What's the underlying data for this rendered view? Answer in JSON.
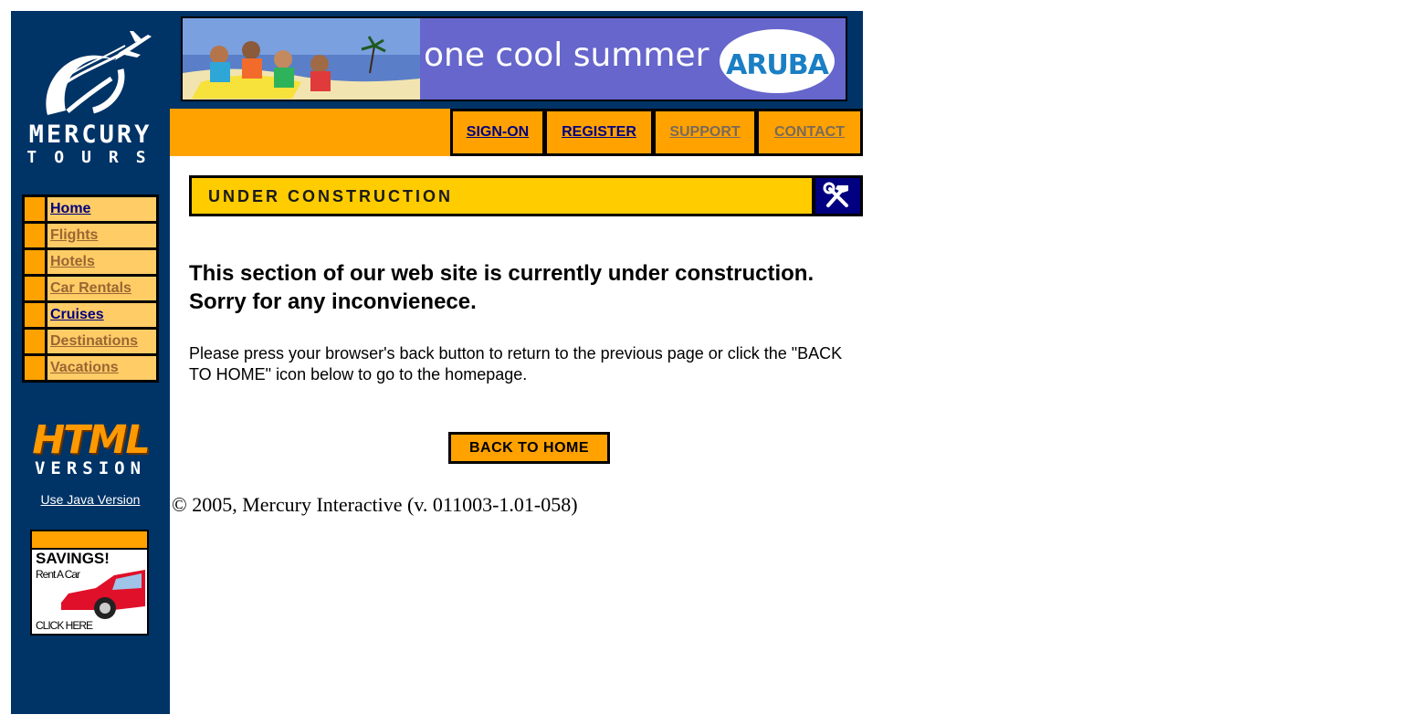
{
  "brand": {
    "name_top": "MERCURY",
    "name_bottom": "TOURS"
  },
  "side_nav": {
    "items": [
      {
        "label": "Home",
        "state": "active"
      },
      {
        "label": "Flights",
        "state": "inactive"
      },
      {
        "label": "Hotels",
        "state": "inactive"
      },
      {
        "label": "Car Rentals",
        "state": "inactive"
      },
      {
        "label": "Cruises",
        "state": "active"
      },
      {
        "label": "Destinations",
        "state": "inactive"
      },
      {
        "label": "Vacations",
        "state": "inactive"
      }
    ]
  },
  "html_badge": {
    "line1": "HTML",
    "line2": "VERSION"
  },
  "java_link": "Use Java Version",
  "savings_ad": {
    "title": "SAVINGS!",
    "subtitle": "Rent A Car",
    "cta": "CLICK HERE"
  },
  "banner": {
    "slogan": "one cool summer",
    "destination": "ARUBA"
  },
  "top_nav": {
    "signon": "SIGN-ON",
    "register": "REGISTER",
    "support": "SUPPORT",
    "contact": "CONTACT"
  },
  "section": {
    "title": "UNDER CONSTRUCTION",
    "icon": "tools-icon",
    "headline": "This section of our web site is currently under construction.   Sorry for any inconvienece.",
    "instructions": "Please press your browser's back button to return to the previous page or click the \"BACK TO HOME\" icon below to go to the homepage.",
    "back_button": "BACK TO HOME"
  },
  "footer": {
    "copyright": "© 2005, Mercury Interactive (v. 011003-1.01-058)"
  },
  "colors": {
    "sidebar": "#003366",
    "orange": "#ffa200",
    "nav_cell": "#ffcc66",
    "uc_yellow": "#ffcc00",
    "link_active": "#000080",
    "link_inactive": "#996633"
  }
}
